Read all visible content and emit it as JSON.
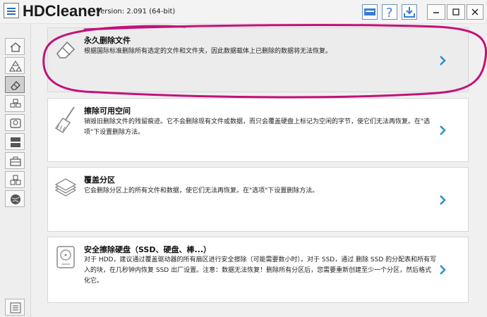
{
  "app": {
    "title": "HDCleaner",
    "version": "Version: 2.091 (64-bit)"
  },
  "toolbar": {
    "icons": [
      "monitor-icon",
      "help-icon",
      "download-icon"
    ],
    "window_controls": [
      "minimize-icon",
      "maximize-icon",
      "close-icon"
    ]
  },
  "sidebar": {
    "items": [
      {
        "icon": "home-icon",
        "active": false
      },
      {
        "icon": "recycle-icon",
        "active": false
      },
      {
        "icon": "eraser-icon",
        "active": true
      },
      {
        "icon": "registry-icon",
        "active": false
      },
      {
        "icon": "disk-icon",
        "active": false
      },
      {
        "icon": "partition-icon",
        "active": false
      },
      {
        "icon": "toolbox-icon",
        "active": false
      },
      {
        "icon": "modules-icon",
        "active": false
      },
      {
        "icon": "globe-icon",
        "active": false
      }
    ],
    "bottom_icon": "settings-list-icon"
  },
  "cards": [
    {
      "title": "永久删除文件",
      "desc": "根据国际标准删除所有选定的文件和文件夹，因此数据载体上已删除的数据将无法恢复。",
      "icon": "eraser-icon",
      "selected": true
    },
    {
      "title": "擦除可用空间",
      "desc": "销毁旧删除文件的残留痕迹。它不会删除现有文件或数据，而只会覆盖硬盘上标记为空闲的字节，使它们无法再恢复。在\"选项\"下设置删除方法。",
      "icon": "broom-icon",
      "selected": false
    },
    {
      "title": "覆盖分区",
      "desc": "它会删除分区上的所有文件和数据，使它们无法再恢复。在\"选项\"下设置删除方法。",
      "icon": "paper-stack-icon",
      "selected": false
    },
    {
      "title": "安全擦除硬盘（SSD、硬盘、棒...）",
      "desc": "对于 HDD，建议通过覆盖驱动器的所有扇区进行安全擦除（可能需要数小时）。对于 SSD，通过 删除 SSD 的分配表和所有写入的块，在几秒钟内恢复 SSD 出厂设置。注意：数据无法恢复！删除所有分区后，您需要重新创建至少一个分区，然后格式化它。",
      "icon": "hard-disk-icon",
      "selected": false
    }
  ],
  "colors": {
    "accent": "#2b8fd0",
    "annotation": "#c2127a",
    "selected_card": "#ececec"
  }
}
